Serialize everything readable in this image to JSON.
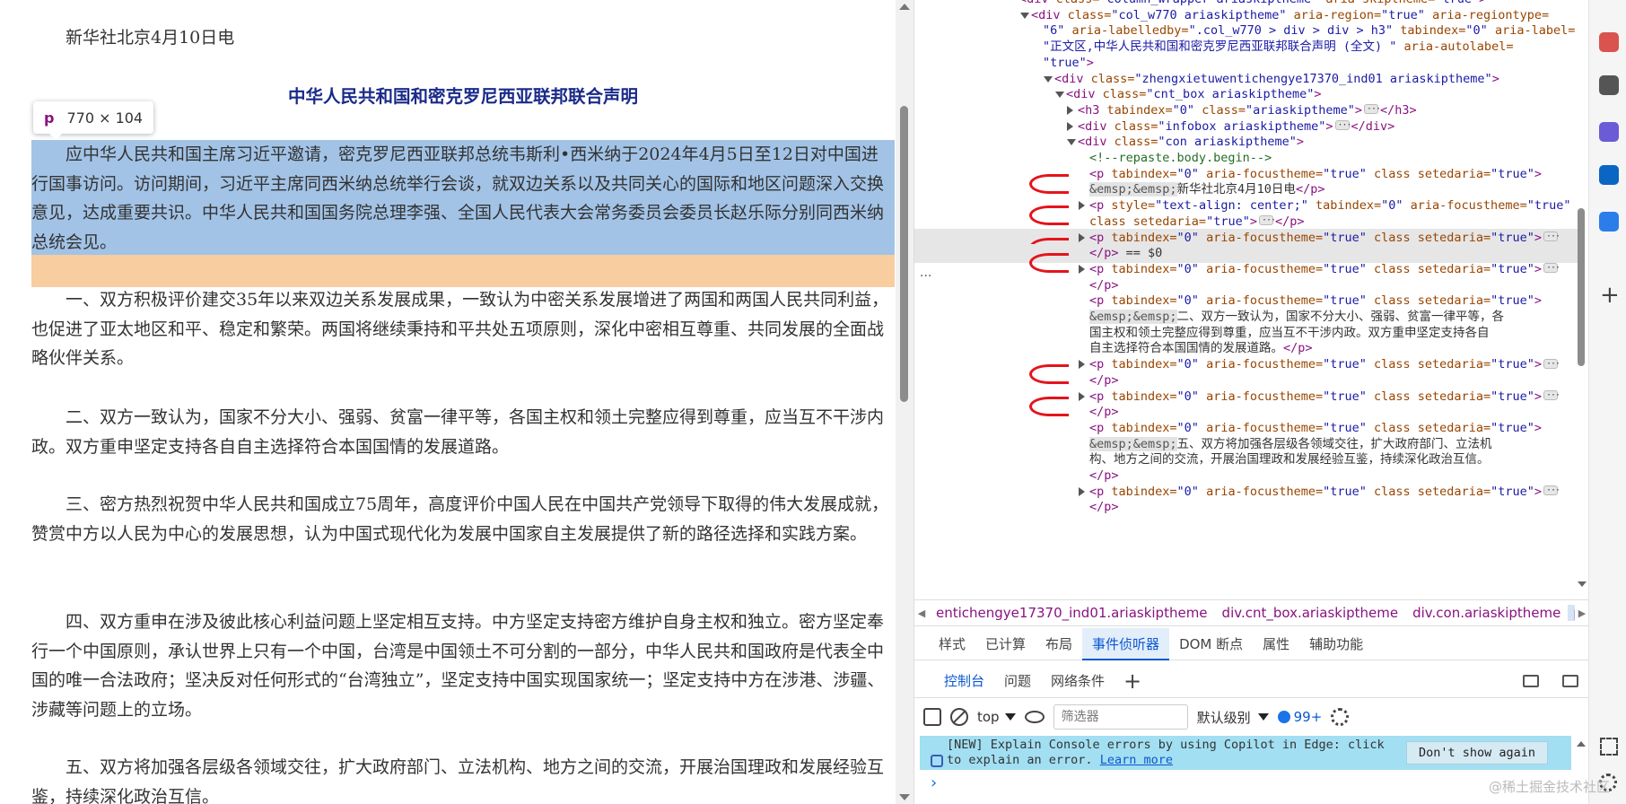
{
  "article": {
    "dateline": "新华社北京4月10日电",
    "title": "中华人民共和国和密克罗尼西亚联邦联合声明",
    "paragraphs": [
      "应中华人民共和国主席习近平邀请，密克罗尼西亚联邦总统韦斯利•西米纳于2024年4月5日至12日对中国进行国事访问。访问期间，习近平主席同西米纳总统举行会谈，就双边关系以及共同关心的国际和地区问题深入交换意见，达成重要共识。中华人民共和国国务院总理李强、全国人民代表大会常务委员会委员长赵乐际分别同西米纳总统会见。",
      "一、双方积极评价建交35年以来双边关系发展成果，一致认为中密关系发展增进了两国和两国人民共同利益，也促进了亚太地区和平、稳定和繁荣。两国将继续秉持和平共处五项原则，深化中密相互尊重、共同发展的全面战略伙伴关系。",
      "二、双方一致认为，国家不分大小、强弱、贫富一律平等，各国主权和领土完整应得到尊重，应当互不干涉内政。双方重申坚定支持各自自主选择符合本国国情的发展道路。",
      "三、密方热烈祝贺中华人民共和国成立75周年，高度评价中国人民在中国共产党领导下取得的伟大发展成就，赞赏中方以人民为中心的发展思想，认为中国式现代化为发展中国家自主发展提供了新的路径选择和实践方案。",
      "四、双方重申在涉及彼此核心利益问题上坚定相互支持。中方坚定支持密方维护自身主权和独立。密方坚定奉行一个中国原则，承认世界上只有一个中国，台湾是中国领土不可分割的一部分，中华人民共和国政府是代表全中国的唯一合法政府；坚决反对任何形式的“台湾独立”，坚定支持中国实现国家统一；坚定支持中方在涉港、涉疆、涉藏等问题上的立场。",
      "五、双方将加强各层级各领域交往，扩大政府部门、立法机构、地方之间的交流，开展治国理政和发展经验互鉴，持续深化政治互信。"
    ],
    "inspect_tooltip": {
      "tag": "p",
      "dimensions": "770 × 104"
    }
  },
  "dom": {
    "lines": [
      {
        "indent": 9,
        "tri": "none",
        "html_parts": [
          [
            "t",
            "<div "
          ],
          [
            "a",
            "class="
          ],
          [
            "v",
            "\"column_wrapper ariaskiptheme\" "
          ],
          [
            "a",
            "aria-skiptheme="
          ],
          [
            "v",
            "\"true\""
          ],
          [
            "t",
            ">"
          ]
        ]
      },
      {
        "indent": 10,
        "tri": "down",
        "html_parts": [
          [
            "t",
            "<div "
          ],
          [
            "a",
            "class="
          ],
          [
            "v",
            "\"col_w770 ariaskiptheme\" "
          ],
          [
            "a",
            "aria-region="
          ],
          [
            "v",
            "\"true\" "
          ],
          [
            "a",
            "aria-regiontype="
          ]
        ]
      },
      {
        "indent": 11,
        "tri": "none",
        "html_parts": [
          [
            "v",
            "\"6\" "
          ],
          [
            "a",
            "aria-labelledby="
          ],
          [
            "v",
            "\".col_w770 > div > div > h3\" "
          ],
          [
            "a",
            "tabindex="
          ],
          [
            "v",
            "\"0\" "
          ],
          [
            "a",
            "aria-label="
          ]
        ]
      },
      {
        "indent": 11,
        "tri": "none",
        "html_parts": [
          [
            "v",
            "\"正文区,中华人民共和国和密克罗尼西亚联邦联合声明 (全文) \" "
          ],
          [
            "a",
            "aria-autolabel="
          ]
        ]
      },
      {
        "indent": 11,
        "tri": "none",
        "html_parts": [
          [
            "v",
            "\"true\""
          ],
          [
            "t",
            ">"
          ]
        ]
      },
      {
        "indent": 12,
        "tri": "down",
        "html_parts": [
          [
            "t",
            "<div "
          ],
          [
            "a",
            "class="
          ],
          [
            "v",
            "\"zhengxietuwentichengye17370_ind01 ariaskiptheme\""
          ],
          [
            "t",
            ">"
          ]
        ]
      },
      {
        "indent": 13,
        "tri": "down",
        "html_parts": [
          [
            "t",
            "<div "
          ],
          [
            "a",
            "class="
          ],
          [
            "v",
            "\"cnt_box ariaskiptheme\""
          ],
          [
            "t",
            ">"
          ]
        ]
      },
      {
        "indent": 14,
        "tri": "right",
        "html_parts": [
          [
            "t",
            "<h3 "
          ],
          [
            "a",
            "tabindex="
          ],
          [
            "v",
            "\"0\" "
          ],
          [
            "a",
            "class="
          ],
          [
            "v",
            "\"ariaskiptheme\""
          ],
          [
            "t",
            ">"
          ],
          [
            "e",
            ""
          ],
          [
            "t",
            "</h3>"
          ]
        ]
      },
      {
        "indent": 14,
        "tri": "right",
        "html_parts": [
          [
            "t",
            "<div "
          ],
          [
            "a",
            "class="
          ],
          [
            "v",
            "\"infobox ariaskiptheme\""
          ],
          [
            "t",
            ">"
          ],
          [
            "e",
            ""
          ],
          [
            "t",
            "</div>"
          ]
        ]
      },
      {
        "indent": 14,
        "tri": "down",
        "html_parts": [
          [
            "t",
            "<div "
          ],
          [
            "a",
            "class="
          ],
          [
            "v",
            "\"con ariaskiptheme\""
          ],
          [
            "t",
            ">"
          ]
        ]
      },
      {
        "indent": 15,
        "tri": "none",
        "html_parts": [
          [
            "c",
            "<!--repaste.body.begin-->"
          ]
        ]
      },
      {
        "indent": 15,
        "tri": "none",
        "html_parts": [
          [
            "t",
            "<p "
          ],
          [
            "a",
            "tabindex="
          ],
          [
            "v",
            "\"0\" "
          ],
          [
            "a",
            "aria-focustheme="
          ],
          [
            "v",
            "\"true\" "
          ],
          [
            "a",
            "class "
          ],
          [
            "a",
            "setedaria="
          ],
          [
            "v",
            "\"true\""
          ],
          [
            "t",
            ">"
          ]
        ]
      },
      {
        "indent": 15,
        "tri": "none",
        "html_parts": [
          [
            "n",
            "&emsp;&emsp;"
          ],
          [
            "x",
            "新华社北京4月10日电"
          ],
          [
            "t",
            "</p>"
          ]
        ]
      },
      {
        "indent": 15,
        "tri": "right",
        "html_parts": [
          [
            "t",
            "<p "
          ],
          [
            "a",
            "style="
          ],
          [
            "v",
            "\"text-align: center;\" "
          ],
          [
            "a",
            "tabindex="
          ],
          [
            "v",
            "\"0\" "
          ],
          [
            "a",
            "aria-focustheme="
          ],
          [
            "v",
            "\"true\""
          ]
        ]
      },
      {
        "indent": 15,
        "tri": "none",
        "html_parts": [
          [
            "a",
            "class "
          ],
          [
            "a",
            "setedaria="
          ],
          [
            "v",
            "\"true\""
          ],
          [
            "t",
            ">"
          ],
          [
            "e",
            ""
          ],
          [
            "t",
            "</p>"
          ]
        ]
      },
      {
        "indent": 15,
        "tri": "right",
        "sel": true,
        "html_parts": [
          [
            "t",
            "<p "
          ],
          [
            "a",
            "tabindex="
          ],
          [
            "v",
            "\"0\" "
          ],
          [
            "a",
            "aria-focustheme="
          ],
          [
            "v",
            "\"true\" "
          ],
          [
            "a",
            "class "
          ],
          [
            "a",
            "setedaria="
          ],
          [
            "v",
            "\"true\""
          ],
          [
            "t",
            ">"
          ],
          [
            "e",
            ""
          ]
        ]
      },
      {
        "indent": 15,
        "tri": "none",
        "sel": true,
        "html_parts": [
          [
            "t",
            "</p>"
          ],
          [
            "x",
            " == $0"
          ]
        ]
      },
      {
        "indent": 15,
        "tri": "right",
        "html_parts": [
          [
            "t",
            "<p "
          ],
          [
            "a",
            "tabindex="
          ],
          [
            "v",
            "\"0\" "
          ],
          [
            "a",
            "aria-focustheme="
          ],
          [
            "v",
            "\"true\" "
          ],
          [
            "a",
            "class "
          ],
          [
            "a",
            "setedaria="
          ],
          [
            "v",
            "\"true\""
          ],
          [
            "t",
            ">"
          ],
          [
            "e",
            ""
          ]
        ]
      },
      {
        "indent": 15,
        "tri": "none",
        "html_parts": [
          [
            "t",
            "</p>"
          ]
        ]
      },
      {
        "indent": 15,
        "tri": "none",
        "html_parts": [
          [
            "t",
            "<p "
          ],
          [
            "a",
            "tabindex="
          ],
          [
            "v",
            "\"0\" "
          ],
          [
            "a",
            "aria-focustheme="
          ],
          [
            "v",
            "\"true\" "
          ],
          [
            "a",
            "class "
          ],
          [
            "a",
            "setedaria="
          ],
          [
            "v",
            "\"true\""
          ],
          [
            "t",
            ">"
          ]
        ]
      },
      {
        "indent": 15,
        "tri": "none",
        "html_parts": [
          [
            "n",
            "&emsp;&emsp;"
          ],
          [
            "x",
            "二、双方一致认为，国家不分大小、强弱、贫富一律平等，各"
          ]
        ]
      },
      {
        "indent": 15,
        "tri": "none",
        "html_parts": [
          [
            "x",
            "国主权和领土完整应得到尊重，应当互不干涉内政。双方重申坚定支持各自"
          ]
        ]
      },
      {
        "indent": 15,
        "tri": "none",
        "html_parts": [
          [
            "x",
            "自主选择符合本国国情的发展道路。"
          ],
          [
            "t",
            "</p>"
          ]
        ]
      },
      {
        "indent": 15,
        "tri": "right",
        "html_parts": [
          [
            "t",
            "<p "
          ],
          [
            "a",
            "tabindex="
          ],
          [
            "v",
            "\"0\" "
          ],
          [
            "a",
            "aria-focustheme="
          ],
          [
            "v",
            "\"true\" "
          ],
          [
            "a",
            "class "
          ],
          [
            "a",
            "setedaria="
          ],
          [
            "v",
            "\"true\""
          ],
          [
            "t",
            ">"
          ],
          [
            "e",
            ""
          ]
        ]
      },
      {
        "indent": 15,
        "tri": "none",
        "html_parts": [
          [
            "t",
            "</p>"
          ]
        ]
      },
      {
        "indent": 15,
        "tri": "right",
        "html_parts": [
          [
            "t",
            "<p "
          ],
          [
            "a",
            "tabindex="
          ],
          [
            "v",
            "\"0\" "
          ],
          [
            "a",
            "aria-focustheme="
          ],
          [
            "v",
            "\"true\" "
          ],
          [
            "a",
            "class "
          ],
          [
            "a",
            "setedaria="
          ],
          [
            "v",
            "\"true\""
          ],
          [
            "t",
            ">"
          ],
          [
            "e",
            ""
          ]
        ]
      },
      {
        "indent": 15,
        "tri": "none",
        "html_parts": [
          [
            "t",
            "</p>"
          ]
        ]
      },
      {
        "indent": 15,
        "tri": "none",
        "html_parts": [
          [
            "t",
            "<p "
          ],
          [
            "a",
            "tabindex="
          ],
          [
            "v",
            "\"0\" "
          ],
          [
            "a",
            "aria-focustheme="
          ],
          [
            "v",
            "\"true\" "
          ],
          [
            "a",
            "class "
          ],
          [
            "a",
            "setedaria="
          ],
          [
            "v",
            "\"true\""
          ],
          [
            "t",
            ">"
          ]
        ]
      },
      {
        "indent": 15,
        "tri": "none",
        "html_parts": [
          [
            "n",
            "&emsp;&emsp;"
          ],
          [
            "x",
            "五、双方将加强各层级各领域交往，扩大政府部门、立法机"
          ]
        ]
      },
      {
        "indent": 15,
        "tri": "none",
        "html_parts": [
          [
            "x",
            "构、地方之间的交流，开展治国理政和发展经验互鉴，持续深化政治互信。"
          ]
        ]
      },
      {
        "indent": 15,
        "tri": "none",
        "html_parts": [
          [
            "t",
            "</p>"
          ]
        ]
      },
      {
        "indent": 15,
        "tri": "right",
        "html_parts": [
          [
            "t",
            "<p "
          ],
          [
            "a",
            "tabindex="
          ],
          [
            "v",
            "\"0\" "
          ],
          [
            "a",
            "aria-focustheme="
          ],
          [
            "v",
            "\"true\" "
          ],
          [
            "a",
            "class "
          ],
          [
            "a",
            "setedaria="
          ],
          [
            "v",
            "\"true\""
          ],
          [
            "t",
            ">"
          ],
          [
            "e",
            ""
          ]
        ]
      },
      {
        "indent": 15,
        "tri": "none",
        "html_parts": [
          [
            "t",
            "</p>"
          ]
        ]
      }
    ]
  },
  "breadcrumbs": {
    "items": [
      "entichengye17370_ind01.ariaskiptheme",
      "div.cnt_box.ariaskiptheme",
      "div.con.ariaskiptheme",
      "p"
    ]
  },
  "styles_tabs": [
    "样式",
    "已计算",
    "布局",
    "事件侦听器",
    "DOM 断点",
    "属性",
    "辅助功能"
  ],
  "active_styles_tab": "事件侦听器",
  "drawer_tabs": [
    "控制台",
    "问题",
    "网络条件"
  ],
  "active_drawer_tab": "控制台",
  "console_toolbar": {
    "context": "top",
    "filter_placeholder": "筛选器",
    "levels": "默认级别",
    "issues_count": "99+"
  },
  "banner": {
    "line1": "[NEW] Explain Console errors by using Copilot in Edge: click",
    "line2_prefix": "to explain an error. ",
    "link": "Learn more",
    "dismiss": "Don't show again"
  },
  "prompt_glyph": "›",
  "watermark": "@稀土掘金技术社区",
  "sidebar_icons": [
    {
      "name": "briefcase-icon",
      "color": "#d9534f"
    },
    {
      "name": "user-group-icon",
      "color": "#555555"
    },
    {
      "name": "copilot-icon",
      "color": "#6b5bd6"
    },
    {
      "name": "outlook-icon",
      "color": "#0a66c2"
    },
    {
      "name": "send-icon",
      "color": "#2b7de9"
    }
  ],
  "colors": {
    "selection_content": "#a2c3e6",
    "selection_padding": "#f8cd9f",
    "title": "#1a2a8a",
    "accent": "#0b57d0"
  }
}
